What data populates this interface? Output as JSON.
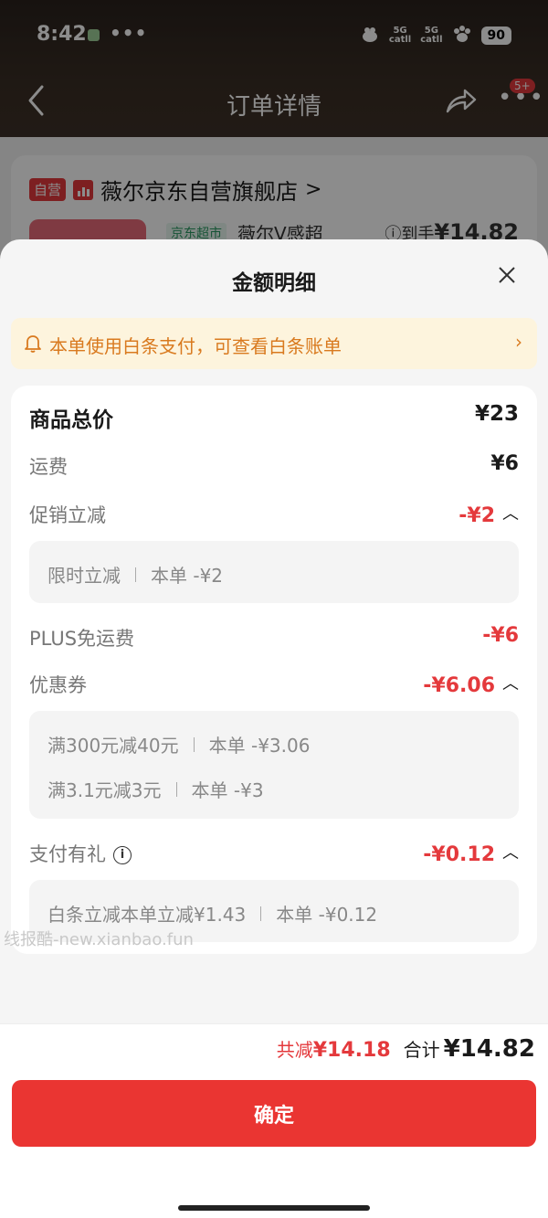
{
  "status_bar": {
    "time": "8:42",
    "dots": "•••",
    "network_1": "5G",
    "network_1_sub": "catll",
    "network_2": "5G",
    "network_2_sub": "catll",
    "battery": "90"
  },
  "nav": {
    "title": "订单详情",
    "badge": "5+"
  },
  "store": {
    "self_tag": "自营",
    "name": "薇尔京东自营旗舰店",
    "chevron": ">",
    "product_tag": "京东超市",
    "product_name": "薇尔V感超",
    "price_prefix": "ⓘ到手",
    "price": "¥14.82"
  },
  "sheet": {
    "title": "金额明细",
    "notice": "本单使用白条支付，可查看白条账单"
  },
  "details": {
    "goods_total_label": "商品总价",
    "goods_total_value": "¥23",
    "shipping_label": "运费",
    "shipping_value": "¥6",
    "promo_label": "促销立减",
    "promo_value": "-¥2",
    "promo_items": [
      {
        "name": "限时立减",
        "amount": "本单 -¥2"
      }
    ],
    "plus_label": "PLUS免运费",
    "plus_value": "-¥6",
    "coupon_label": "优惠券",
    "coupon_value": "-¥6.06",
    "coupon_items": [
      {
        "name": "满300元减40元",
        "amount": "本单 -¥3.06"
      },
      {
        "name": "满3.1元减3元",
        "amount": "本单 -¥3"
      }
    ],
    "pay_gift_label": "支付有礼",
    "pay_gift_value": "-¥0.12",
    "pay_gift_items": [
      {
        "name": "白条立减本单立减¥1.43",
        "amount": "本单 -¥0.12"
      }
    ]
  },
  "watermark": "线报酷-new.xianbao.fun",
  "bottom": {
    "discount_label": "共减",
    "discount_value": "¥14.18",
    "total_label": "合计",
    "total_value": "¥14.82",
    "confirm_label": "确定"
  },
  "colors": {
    "accent_red": "#e4393c",
    "notice_text": "#d97a1f",
    "notice_bg": "#fdf4dd"
  }
}
